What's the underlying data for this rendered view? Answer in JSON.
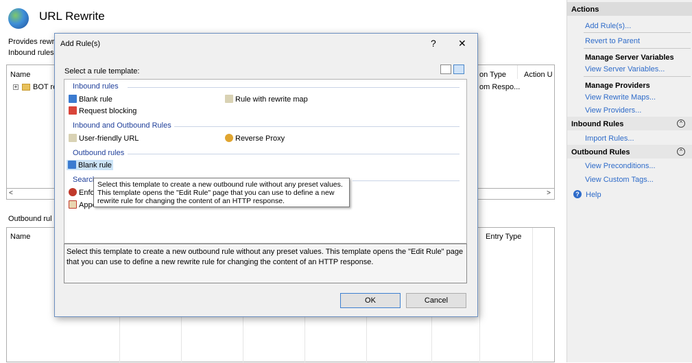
{
  "page": {
    "title": "URL Rewrite",
    "description_partial": "Provides rewri",
    "inbound_label_partial": "Inbound rules",
    "outbound_label_partial": "Outbound rul"
  },
  "inbound_grid": {
    "columns": [
      "Name",
      "on Type",
      "Action U"
    ],
    "rows": [
      {
        "name": "BOT re",
        "type": "om Respo..."
      }
    ]
  },
  "outbound_grid": {
    "columns": [
      "Name",
      "Entry Type"
    ]
  },
  "actions": {
    "header": "Actions",
    "add_rules": "Add Rule(s)...",
    "revert": "Revert to Parent",
    "manage_server_vars": "Manage Server Variables",
    "view_server_vars": "View Server Variables...",
    "manage_providers": "Manage Providers",
    "view_rewrite_maps": "View Rewrite Maps...",
    "view_providers": "View Providers...",
    "inbound_header": "Inbound Rules",
    "import_rules": "Import Rules...",
    "outbound_header": "Outbound Rules",
    "view_preconditions": "View Preconditions...",
    "view_custom_tags": "View Custom Tags...",
    "help": "Help"
  },
  "dialog": {
    "title": "Add Rule(s)",
    "help_glyph": "?",
    "close_glyph": "✕",
    "select_label": "Select a rule template:",
    "groups": {
      "inbound": "Inbound rules",
      "inout": "Inbound and Outbound Rules",
      "outbound": "Outbound rules",
      "search": "Search"
    },
    "items": {
      "blank_rule_in": "Blank rule",
      "rule_rewrite_map": "Rule with rewrite map",
      "request_blocking": "Request blocking",
      "user_friendly_url": "User-friendly URL",
      "reverse_proxy": "Reverse Proxy",
      "blank_rule_out": "Blank rule",
      "enfo": "Enfo",
      "appe": "Appe"
    },
    "tooltip": "Select this template to create a new outbound rule without any preset values. This template opens the \"Edit Rule\" page that you can use to define a new rewrite rule for changing the content of an HTTP response.",
    "description": "Select this template to create a new outbound rule without any preset values. This template opens the \"Edit Rule\" page that you can use to define a new rewrite rule for changing the content of an HTTP response.",
    "ok": "OK",
    "cancel": "Cancel"
  }
}
